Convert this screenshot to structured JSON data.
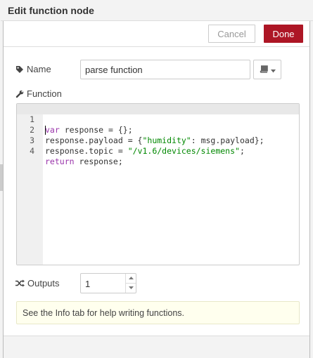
{
  "header": {
    "title": "Edit function node"
  },
  "buttons": {
    "cancel": "Cancel",
    "done": "Done"
  },
  "name_field": {
    "label": "Name",
    "value": "parse function"
  },
  "function_field": {
    "label": "Function",
    "lines": [
      {
        "num": "1",
        "text": "var response = {};"
      },
      {
        "num": "2",
        "text": "response.payload = {\"humidity\": msg.payload};"
      },
      {
        "num": "3",
        "text": "response.topic = \"/v1.6/devices/siemens\";"
      },
      {
        "num": "4",
        "text": "return response;"
      }
    ]
  },
  "outputs_field": {
    "label": "Outputs",
    "value": "1"
  },
  "tip": {
    "text": "See the Info tab for help writing functions."
  },
  "icons": {
    "name": "tag-icon",
    "function": "wrench-icon",
    "outputs": "shuffle-icon",
    "library": "book-icon",
    "dropdown": "caret-down-icon"
  },
  "colors": {
    "done_button": "#ad1625",
    "tip_background": "#ffffee",
    "keyword": "#9933aa",
    "string": "#008800"
  }
}
